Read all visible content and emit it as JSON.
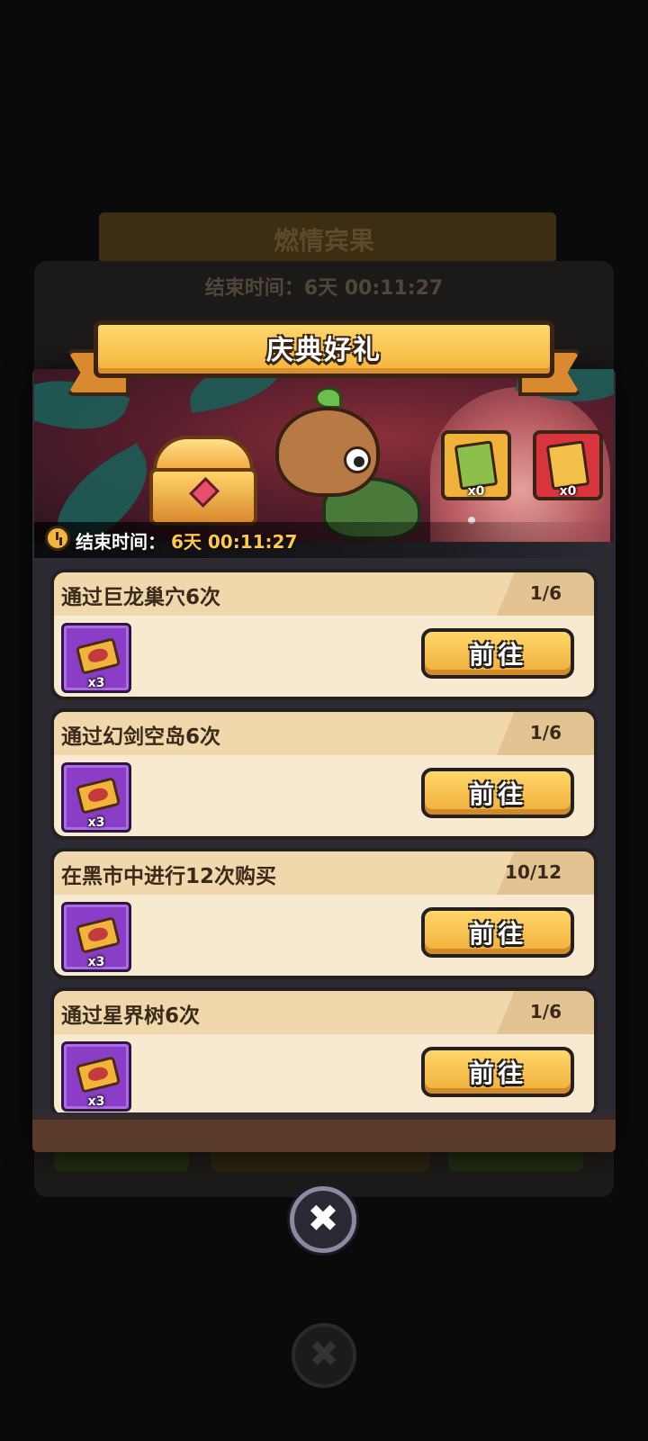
{
  "background": {
    "title": "燃情宾果",
    "timer": "结束时间：6天 00:11:27"
  },
  "dialog": {
    "title": "庆典好礼",
    "timer_label": "结束时间：",
    "timer_value": "6天 00:11:27",
    "currency": [
      {
        "icon": "green-ticket-icon",
        "count": "x0"
      },
      {
        "icon": "gold-ticket-icon",
        "count": "x0"
      }
    ],
    "go_label": "前往",
    "tasks": [
      {
        "title": "通过巨龙巢穴6次",
        "progress": "1/6",
        "reward": "x3"
      },
      {
        "title": "通过幻剑空岛6次",
        "progress": "1/6",
        "reward": "x3"
      },
      {
        "title": "在黑市中进行12次购买",
        "progress": "10/12",
        "reward": "x3"
      },
      {
        "title": "通过星界树6次",
        "progress": "1/6",
        "reward": "x3"
      }
    ],
    "close_icon": "✖"
  },
  "colors": {
    "accent": "#f2b33a",
    "reward_bg": "#8a3ec8",
    "panel": "#2c2b33"
  }
}
